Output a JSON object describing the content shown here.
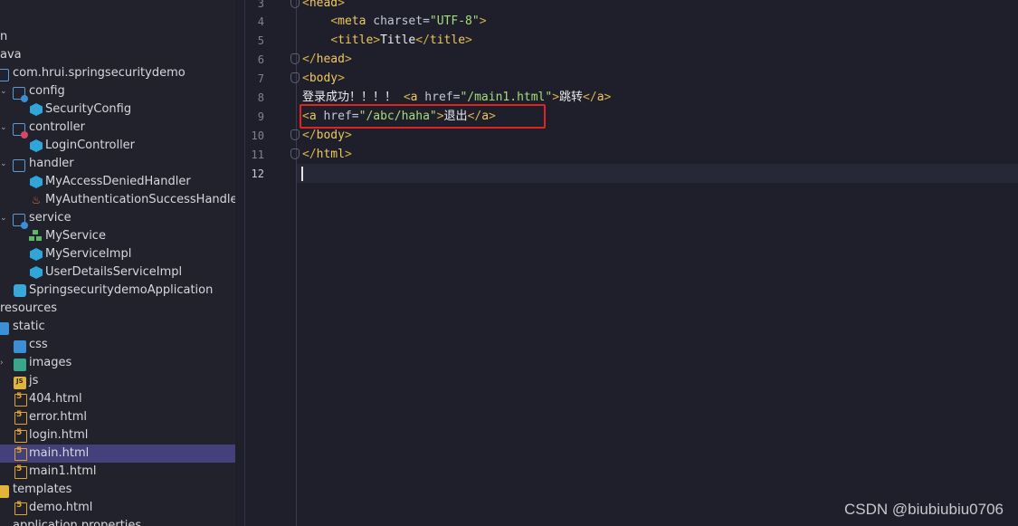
{
  "tree": {
    "items": [
      {
        "label": "n",
        "icon": "none"
      },
      {
        "label": "ava",
        "icon": "none"
      },
      {
        "label": "com.hrui.springsecuritydemo",
        "icon": "package-folder-icon"
      },
      {
        "label": "config",
        "icon": "config-folder-icon"
      },
      {
        "label": "SecurityConfig",
        "icon": "class-icon"
      },
      {
        "label": "controller",
        "icon": "controller-folder-icon"
      },
      {
        "label": "LoginController",
        "icon": "class-icon"
      },
      {
        "label": "handler",
        "icon": "folder-icon"
      },
      {
        "label": "MyAccessDeniedHandler",
        "icon": "class-icon"
      },
      {
        "label": "MyAuthenticationSuccessHandler.jav",
        "icon": "java-file-icon"
      },
      {
        "label": "service",
        "icon": "service-folder-icon"
      },
      {
        "label": "MyService",
        "icon": "interface-icon"
      },
      {
        "label": "MyServiceImpl",
        "icon": "class-icon"
      },
      {
        "label": "UserDetailsServiceImpl",
        "icon": "class-icon"
      },
      {
        "label": "SpringsecuritydemoApplication",
        "icon": "spring-app-icon"
      },
      {
        "label": "resources",
        "icon": "none"
      },
      {
        "label": "static",
        "icon": "web-folder-icon"
      },
      {
        "label": "css",
        "icon": "css-folder-icon"
      },
      {
        "label": "images",
        "icon": "images-folder-icon"
      },
      {
        "label": "js",
        "icon": "js-folder-icon"
      },
      {
        "label": "404.html",
        "icon": "html-icon"
      },
      {
        "label": "error.html",
        "icon": "html-icon"
      },
      {
        "label": "login.html",
        "icon": "html-icon"
      },
      {
        "label": "main.html",
        "icon": "html-icon"
      },
      {
        "label": "main1.html",
        "icon": "html-icon"
      },
      {
        "label": "templates",
        "icon": "templates-folder-icon"
      },
      {
        "label": "demo.html",
        "icon": "html-icon"
      },
      {
        "label": "application.properties",
        "icon": "properties-icon"
      }
    ],
    "selected": "main.html"
  },
  "editor": {
    "line_numbers": [
      "3",
      "4",
      "5",
      "6",
      "7",
      "8",
      "9",
      "10",
      "11",
      "12"
    ],
    "current_line": "12",
    "lines": {
      "l3": {
        "open": "<",
        "tag": "head",
        "close": ">"
      },
      "l4": {
        "indent": "    ",
        "open": "<",
        "tag": "meta",
        "attr": " charset=",
        "val": "\"UTF-8\"",
        "close": ">"
      },
      "l5": {
        "indent": "    ",
        "open": "<",
        "tag": "title",
        "close": ">",
        "text": "Title",
        "end_open": "</",
        "end_tag": "title",
        "end_close": ">"
      },
      "l6": {
        "open": "</",
        "tag": "head",
        "close": ">"
      },
      "l7": {
        "open": "<",
        "tag": "body",
        "close": ">"
      },
      "l8": {
        "text": "登录成功！！！！ ",
        "open": "<",
        "tag": "a",
        "attr": " href=",
        "val": "\"/main1.html\"",
        "close": ">",
        "text2": "跳转",
        "end_open": "</",
        "end_tag": "a",
        "end_close": ">"
      },
      "l9": {
        "open": "<",
        "tag": "a",
        "attr": " href=",
        "val": "\"/abc/haha\"",
        "close": ">",
        "text": "退出",
        "end_open": "</",
        "end_tag": "a",
        "end_close": ">"
      },
      "l10": {
        "open": "</",
        "tag": "body",
        "close": ">"
      },
      "l11": {
        "open": "</",
        "tag": "html",
        "close": ">"
      }
    }
  },
  "watermark": "CSDN @biubiubiu0706",
  "colors": {
    "highlight": "#e02424",
    "selection": "#44407b",
    "tag": "#f0c860",
    "string": "#a7dc7a"
  }
}
